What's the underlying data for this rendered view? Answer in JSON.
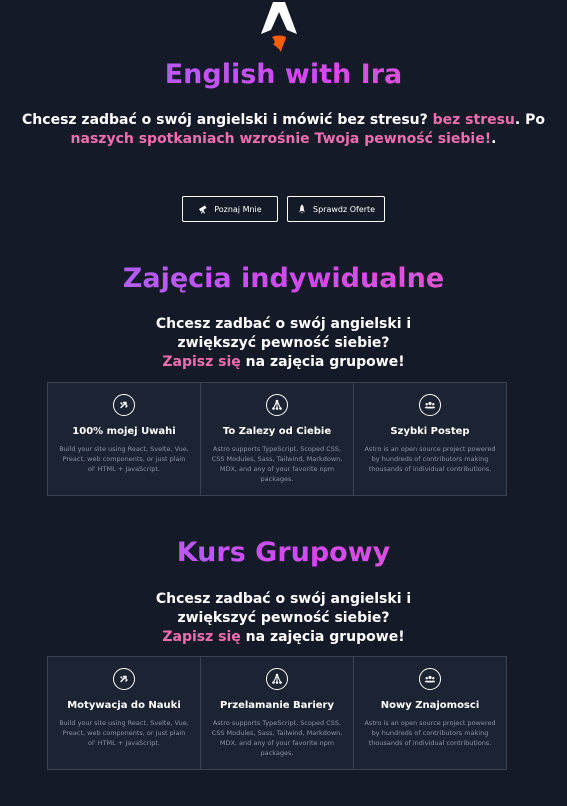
{
  "hero": {
    "title": "English with Ira",
    "lead_parts": [
      "Chcesz zadbać o swój angielski i mówić bez stresu? ",
      "bez stresu",
      ". Po ",
      "naszych spotkaniach wzrośnie Twoja pewność siebie!",
      "."
    ],
    "buttons": [
      {
        "label": "Poznaj Mnie",
        "icon": "telescope-icon"
      },
      {
        "label": "Sprawdz Oferte",
        "icon": "rocket-icon"
      }
    ]
  },
  "individual": {
    "title": "Zajęcia indywidualne",
    "lead_line1": "Chcesz zadbać o swój angielski i",
    "lead_line2": "zwiększyć pewność siebie?",
    "lead_pink": "Zapisz się",
    "lead_tail": " na zajęcia grupowe!",
    "cards": [
      {
        "title": "100% mojej Uwahi",
        "icon": "swap-icon",
        "desc": "Build your site using React, Svelte, Vue, Preact, web components, or just plain ol' HTML + JavaScript."
      },
      {
        "title": "To Zalezy od Ciebie",
        "icon": "nodes-icon",
        "desc": "Astro supports TypeScript, Scoped CSS, CSS Modules, Sass, Tailwind, Markdown, MDX, and any of your favorite npm packages."
      },
      {
        "title": "Szybki Postep",
        "icon": "people-icon",
        "desc": "Astro is an open source project powered by hundreds of contributors making thousands of individual contributions."
      }
    ]
  },
  "group": {
    "title": "Kurs Grupowy",
    "lead_line1": "Chcesz zadbać o swój angielski i",
    "lead_line2": "zwiększyć pewność siebie?",
    "lead_pink": "Zapisz się",
    "lead_tail": " na zajęcia grupowe!",
    "cards": [
      {
        "title": "Motywacja do Nauki",
        "icon": "swap-icon",
        "desc": "Build your site using React, Svelte, Vue, Preact, web components, or just plain ol' HTML + JavaScript."
      },
      {
        "title": "Przelamanie Bariery",
        "icon": "nodes-icon",
        "desc": "Astro supports TypeScript, Scoped CSS, CSS Modules, Sass, Tailwind, Markdown, MDX, and any of your favorite npm packages."
      },
      {
        "title": "Nowy Znajomosci",
        "icon": "people-icon",
        "desc": "Astro is an open source project powered by hundreds of contributors making thousands of individual contributions."
      }
    ]
  },
  "colors": {
    "background": "#141a28",
    "accent_pink": "#f06fb0",
    "gradient_start": "#9d6bff",
    "gradient_end": "#ee5fb7",
    "card_bg": "#1c2332",
    "logo_flame": "#ff5d01"
  }
}
